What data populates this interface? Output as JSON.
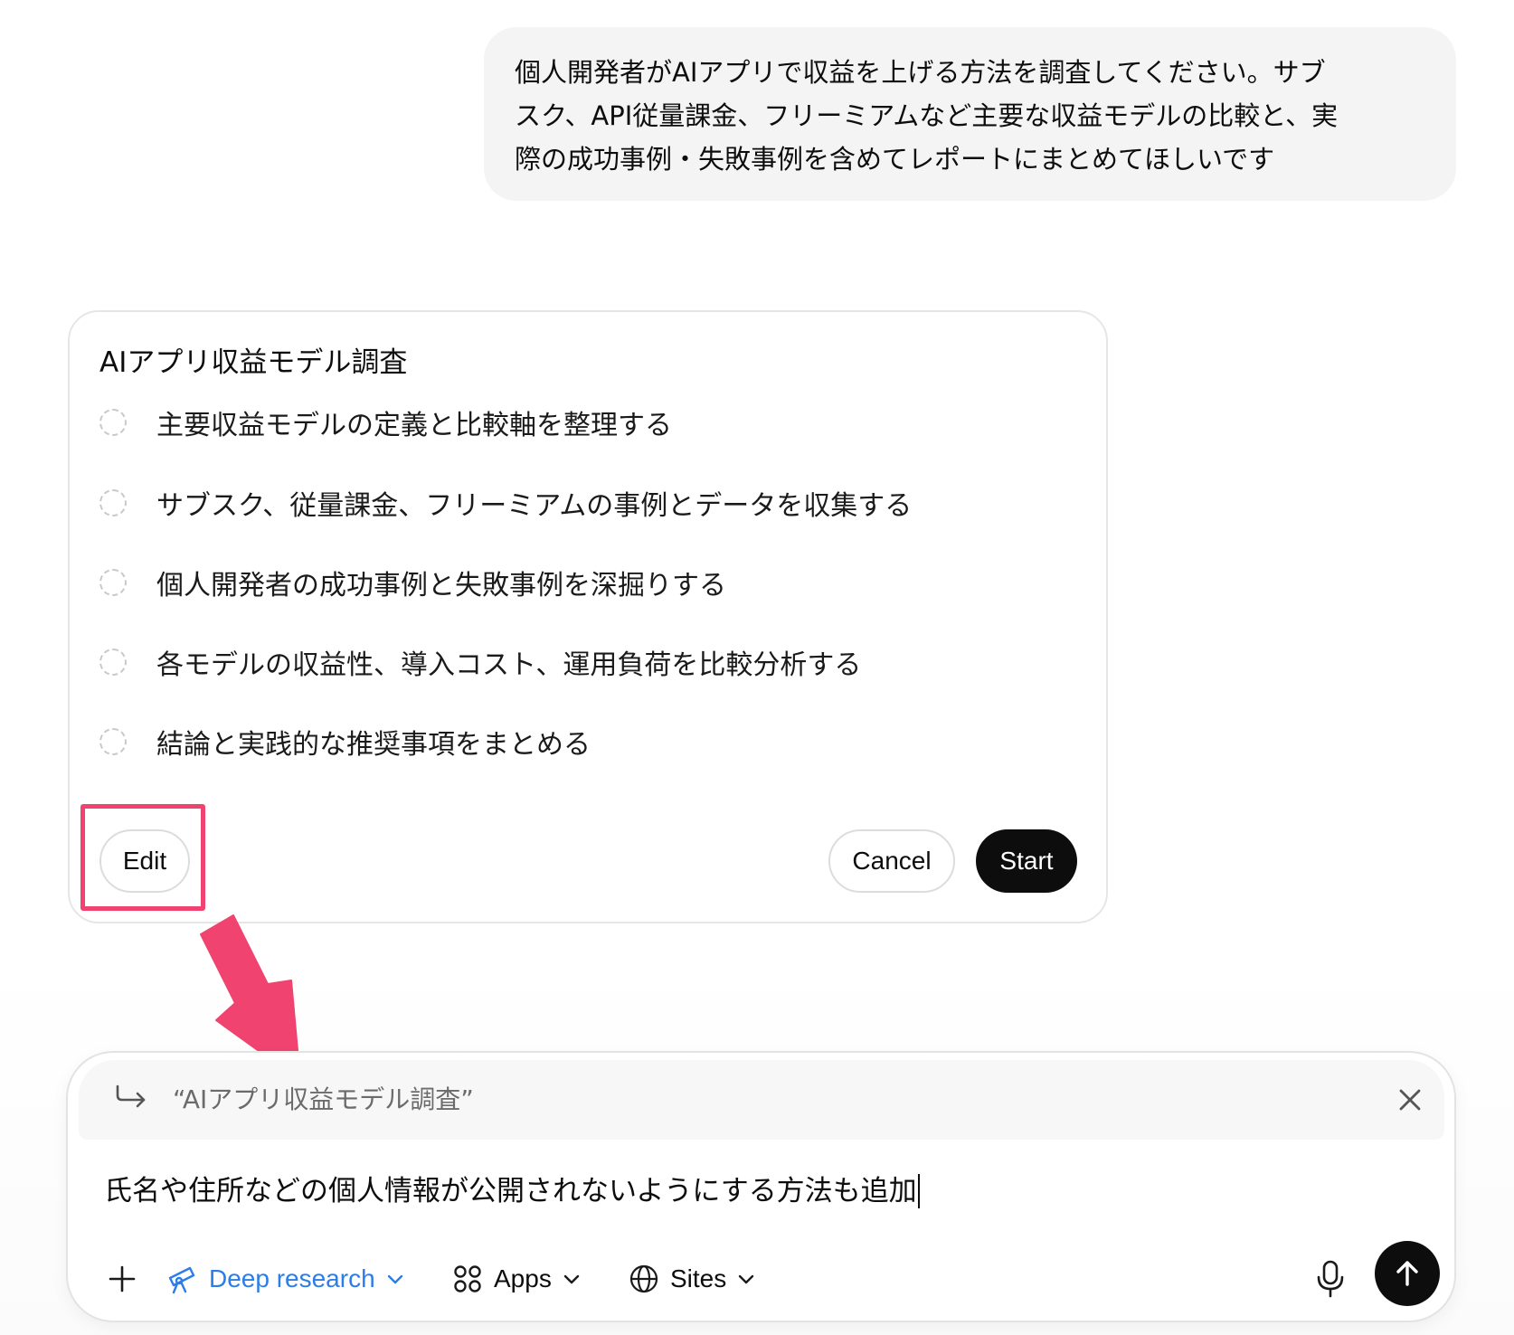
{
  "user_message": {
    "lines": [
      "個人開発者がAIアプリで収益を上げる方法を調査してください。サブ",
      "スク、API従量課金、フリーミアムなど主要な収益モデルの比較と、実",
      "際の成功事例・失敗事例を含めてレポートにまとめてほしいです"
    ]
  },
  "plan": {
    "title": "AIアプリ収益モデル調査",
    "steps": [
      "主要収益モデルの定義と比較軸を整理する",
      "サブスク、従量課金、フリーミアムの事例とデータを収集する",
      "個人開発者の成功事例と失敗事例を深掘りする",
      "各モデルの収益性、導入コスト、運用負荷を比較分析する",
      "結論と実践的な推奨事項をまとめる"
    ],
    "edit_label": "Edit",
    "cancel_label": "Cancel",
    "start_label": "Start"
  },
  "composer": {
    "quote": "“AIアプリ収益モデル調査”",
    "input_value": "氏名や住所などの個人情報が公開されないようにする方法も追加",
    "tools": {
      "deep_research": "Deep research",
      "apps": "Apps",
      "sites": "Sites"
    }
  },
  "colors": {
    "accent_blue": "#2b7de9",
    "annotation_pink": "#f0436f",
    "bubble_gray": "#f4f4f4",
    "primary_black": "#0d0d0d"
  },
  "icons": {
    "reply": "reply-arrow-icon",
    "close": "close-icon",
    "plus": "plus-icon",
    "deep_research": "telescope-icon",
    "apps": "apps-grid-icon",
    "sites": "globe-icon",
    "chevron": "chevron-down-icon",
    "mic": "microphone-icon",
    "send": "arrow-up-icon"
  }
}
